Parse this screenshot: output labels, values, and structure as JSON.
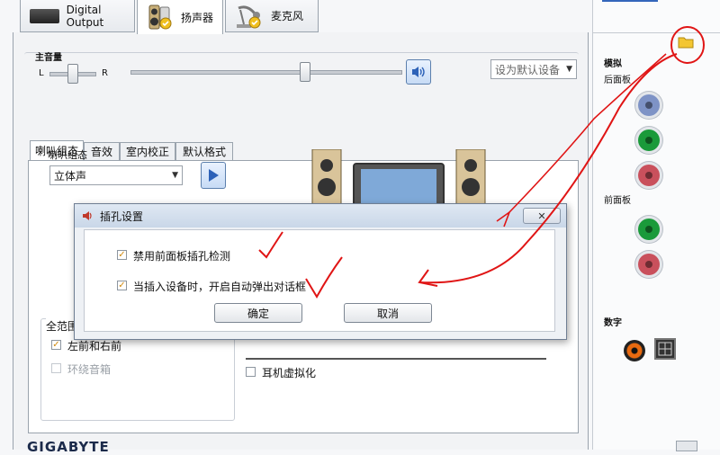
{
  "top_tabs": [
    {
      "label": "Digital Output"
    },
    {
      "label": "扬声器"
    },
    {
      "label": "麦克风"
    }
  ],
  "main_volume": {
    "label": "主音量",
    "left": "L",
    "right": "R",
    "balance": 0.5,
    "level": 0.65,
    "set_default_label": "设为默认设备"
  },
  "sub_tabs": [
    "喇叭组态",
    "音效",
    "室内校正",
    "默认格式"
  ],
  "speaker_config": {
    "group_label": "喇叭组态",
    "selected": "立体声"
  },
  "full_range": {
    "label": "全范围",
    "front_lr": "左前和右前",
    "front_lr_checked": true,
    "surround": "环绕音箱",
    "surround_checked": false
  },
  "headphone_virtualization": {
    "label": "耳机虚拟化",
    "checked": false
  },
  "right_panel": {
    "link_fragment": "—",
    "analog": "模拟",
    "back_panel": "后面板",
    "front_panel": "前面板",
    "digital": "数字",
    "jack_colors": {
      "back": [
        "#7e93c6",
        "#1a9a3a",
        "#c9505c"
      ],
      "front": [
        "#1a9a3a",
        "#c9505c"
      ]
    }
  },
  "dialog": {
    "title": "插孔设置",
    "option1": "禁用前面板插孔检测",
    "option1_checked": true,
    "option2": "当插入设备时，开启自动弹出对话框",
    "option2_checked": true,
    "ok": "确定",
    "cancel": "取消"
  },
  "footer": {
    "brand": "GIGABYTE"
  },
  "colors": {
    "annotation": "#e01515",
    "accent_blue": "#2d62b8"
  }
}
